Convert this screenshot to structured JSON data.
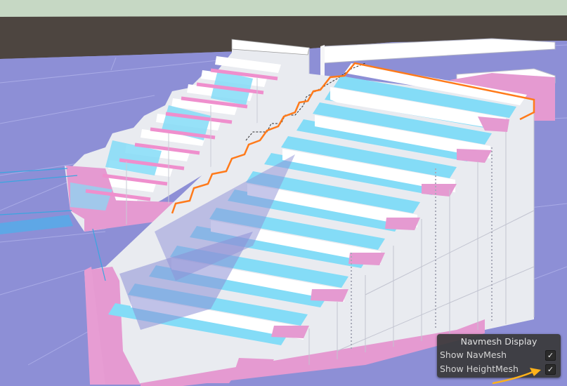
{
  "navmesh_display": {
    "title": "Navmesh Display",
    "show_navmesh": {
      "label": "Show NavMesh",
      "checked": true,
      "check_glyph": "✓"
    },
    "show_heightmesh": {
      "label": "Show HeightMesh",
      "checked": true,
      "check_glyph": "✓"
    }
  },
  "colors": {
    "navmesh": "#8d8fd6",
    "sky": "#c6d8c4",
    "ground_dark": "#4d4540",
    "step_face": "#eceef2",
    "heightmesh_pink": "#e59ad1",
    "slope_blue": "#84dcf7",
    "selection_outline": "#ff7a1a",
    "annotation_arrow": "#ffb21a",
    "overlay_bg": "#383838"
  },
  "icons": {
    "checkbox": "check-icon",
    "annotation": "arrow-icon"
  }
}
